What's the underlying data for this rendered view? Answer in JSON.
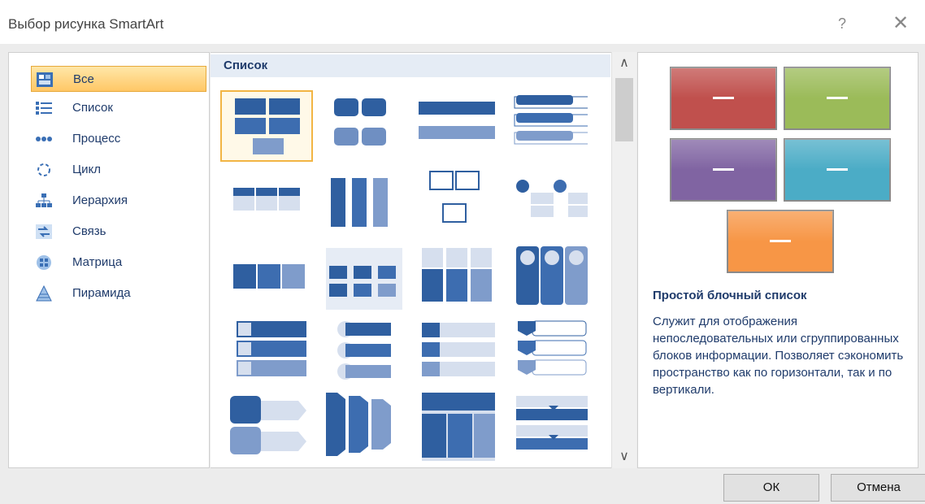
{
  "window": {
    "title": "Выбор рисунка SmartArt",
    "help_glyph": "?",
    "close_glyph": "✕"
  },
  "categories": [
    {
      "label": "Все",
      "icon": "all-icon",
      "selected": true
    },
    {
      "label": "Список",
      "icon": "list-icon"
    },
    {
      "label": "Процесс",
      "icon": "process-icon"
    },
    {
      "label": "Цикл",
      "icon": "cycle-icon"
    },
    {
      "label": "Иерархия",
      "icon": "hierarchy-icon"
    },
    {
      "label": "Связь",
      "icon": "relationship-icon"
    },
    {
      "label": "Матрица",
      "icon": "matrix-icon"
    },
    {
      "label": "Пирамида",
      "icon": "pyramid-icon"
    }
  ],
  "gallery": {
    "section_title": "Список",
    "selected_index": 0
  },
  "scroll": {
    "up_glyph": "∧",
    "down_glyph": "∨"
  },
  "preview": {
    "title": "Простой блочный список",
    "description": "Служит для отображения непоследовательных или сгруппированных блоков информации. Позволяет сэкономить пространство как по горизонтали, так и по вертикали.",
    "block_colors": [
      "#c0504d",
      "#9bbb59",
      "#8064a2",
      "#4bacc6",
      "#f79646"
    ]
  },
  "buttons": {
    "ok": "ОК",
    "cancel": "Отмена"
  },
  "colors": {
    "accent": "#1f3b6b",
    "selection": "#ffc766",
    "thumb_dark": "#2f5fa0",
    "thumb_light": "#c6d3e6"
  }
}
